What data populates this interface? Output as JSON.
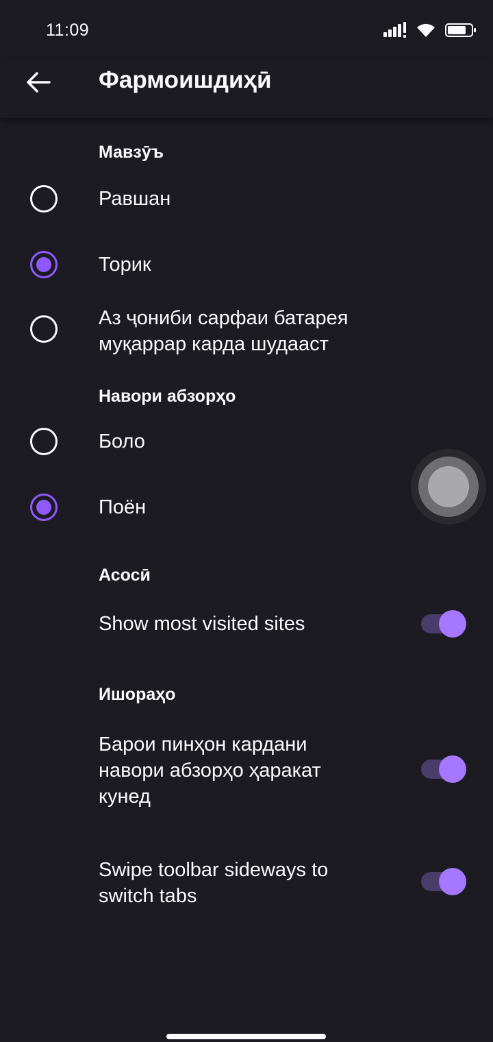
{
  "status_bar": {
    "time": "11:09",
    "icons": [
      "signal-icon",
      "wifi-icon",
      "battery-icon"
    ]
  },
  "header": {
    "title": "Фармоишдиҳӣ",
    "back_icon": "arrow-left-icon"
  },
  "theme_section": {
    "title": "Мавзӯъ",
    "options": [
      {
        "label": "Равшан",
        "checked": false
      },
      {
        "label": "Торик",
        "checked": true
      },
      {
        "label_line1": "Аз ҷониби сарфаи батарея",
        "label_line2": "муқаррар карда шудааст",
        "checked": false
      }
    ]
  },
  "toolbar_section": {
    "title": "Навори абзорҳо",
    "options": [
      {
        "label": "Боло",
        "checked": false
      },
      {
        "label": "Поён",
        "checked": true
      }
    ]
  },
  "general_section": {
    "title": "Асосӣ",
    "items": [
      {
        "label": "Show most visited sites",
        "enabled": true
      }
    ]
  },
  "gestures_section": {
    "title": "Ишораҳо",
    "items": [
      {
        "label_line1": "Барои пинҳон кардани",
        "label_line2": "навори абзорҳо ҳаракат",
        "label_line3": "кунед",
        "enabled": true
      },
      {
        "label_line1": "Swipe toolbar sideways to",
        "label_line2": "switch tabs",
        "enabled": true
      }
    ]
  },
  "colors": {
    "accent": "#9059ff",
    "background": "#1c1b22",
    "text": "#fbfbfe",
    "toggle_track": "#4a3d6b",
    "toggle_thumb": "#a677ff"
  }
}
